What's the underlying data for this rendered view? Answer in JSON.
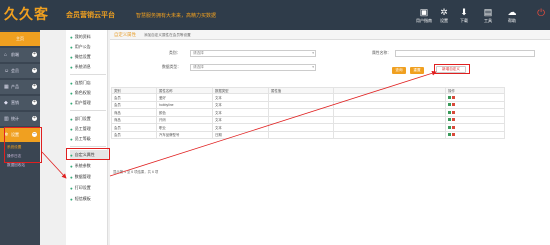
{
  "header": {
    "logo_text": "久久客",
    "brand": "会员营销云平台",
    "tagline": "智慧服务拥有大未来，高精力买数据",
    "icons": [
      {
        "label": "用户指南",
        "icon": "book-icon"
      },
      {
        "label": "设置",
        "icon": "gear-icon"
      },
      {
        "label": "下载",
        "icon": "download-icon"
      },
      {
        "label": "工具",
        "icon": "tools-icon"
      },
      {
        "label": "帮助",
        "icon": "help-icon"
      }
    ],
    "power_icon": "power-icon"
  },
  "sidebar": {
    "top_label": "主页",
    "items": [
      {
        "label": "前端",
        "icon": "home-icon"
      },
      {
        "label": "会员",
        "icon": "user-icon"
      },
      {
        "label": "产品",
        "icon": "box-icon"
      },
      {
        "label": "营销",
        "icon": "megaphone-icon"
      },
      {
        "label": "统计",
        "icon": "chart-icon"
      },
      {
        "label": "设置",
        "icon": "gear-icon"
      }
    ],
    "subitems": [
      "系统设置",
      "操作日志",
      "数据回收站"
    ]
  },
  "midnav": {
    "items": [
      "我的资料",
      "用户公告",
      "微信设置",
      "系统消息",
      "连锁门店",
      "角色权限",
      "用户管理",
      "部门设置",
      "员工管理",
      "员工等级",
      "自定义属性",
      "系统参数",
      "数据管理",
      "打印设置",
      "短信模板"
    ]
  },
  "main": {
    "tab_title": "自定义属性",
    "tab_desc": "添加自定义属性在会员等设置",
    "filter": {
      "type_label": "类别：",
      "type_value": "请选择",
      "data_type_label": "数据类型：",
      "data_type_value": "请选择",
      "name_label": "属性名称：",
      "name_value": ""
    },
    "buttons": {
      "query": "查询",
      "reset": "重置",
      "add": "新增自定义"
    },
    "table": {
      "headers": [
        "类别",
        "属性名称",
        "数据类型",
        "属性值",
        "",
        "操作"
      ],
      "rows": [
        [
          "会员",
          "爱好",
          "文本",
          "",
          "",
          ""
        ],
        [
          "会员",
          "hobbyline",
          "文本",
          "",
          "",
          ""
        ],
        [
          "商品",
          "颜色",
          "文本",
          "",
          "",
          ""
        ],
        [
          "商品",
          "尺码",
          "文本",
          "",
          "",
          ""
        ],
        [
          "会员",
          "职业",
          "文本",
          "",
          "",
          ""
        ],
        [
          "会员",
          "汽车品牌型号",
          "日期",
          "",
          "",
          ""
        ]
      ]
    },
    "footer": "显示第 1 至 6 项结果，共 6 项"
  }
}
